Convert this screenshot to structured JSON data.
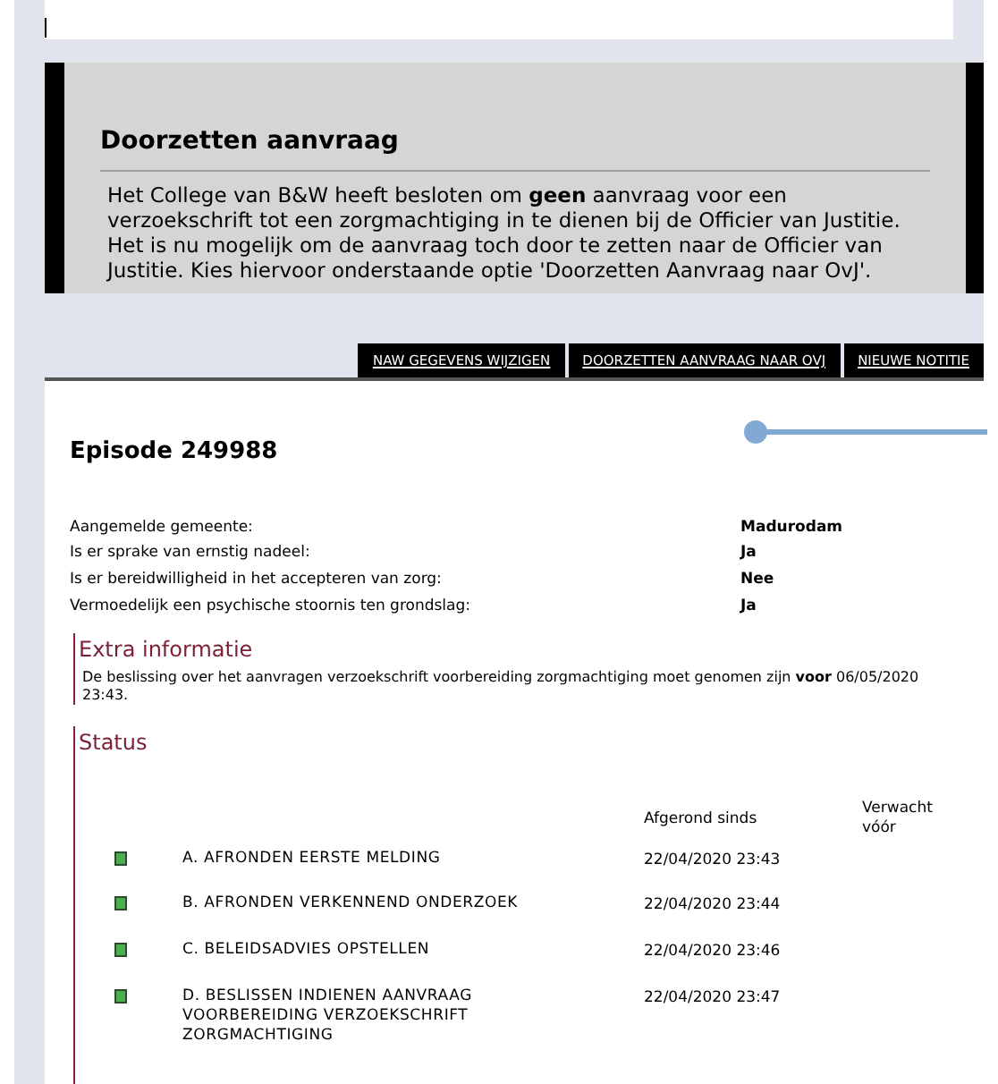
{
  "notice": {
    "title": "Doorzetten aanvraag",
    "body": "Het College van B&W heeft besloten om **geen** aanvraag voor een verzoekschrift tot een zorgmachtiging in te dienen bij de Officier van Justitie. Het is nu mogelijk om de aanvraag toch door te zetten naar de Officier van Justitie. Kies hiervoor onderstaande optie 'Doorzetten Aanvraag naar OvJ'."
  },
  "actions": [
    "NAW GEGEVENS WIJZIGEN",
    "DOORZETTEN AANVRAAG NAAR OVJ",
    "NIEUWE NOTITIE"
  ],
  "episode": {
    "title": "Episode 249988"
  },
  "fields": [
    {
      "label": "Aangemelde gemeente:",
      "value": "Madurodam"
    },
    {
      "label": "Is er sprake van ernstig nadeel:",
      "value": "Ja"
    },
    {
      "label": "Is er bereidwilligheid in het accepteren van zorg:",
      "value": "Nee"
    },
    {
      "label": "Vermoedelijk een psychische stoornis ten grondslag:",
      "value": "Ja"
    }
  ],
  "extra_info": {
    "title": "Extra informatie",
    "text": "De beslissing over het aanvragen verzoekschrift voorbereiding zorgmachtiging moet genomen zijn **voor** 06/05/2020 23:43."
  },
  "status": {
    "title": "Status",
    "columns": [
      "Afgerond sinds",
      "Verwacht vóór"
    ],
    "rows": [
      {
        "step": "A. AFRONDEN EERSTE MELDING",
        "completed": "22/04/2020 23:43",
        "color": "#4caf50"
      },
      {
        "step": "B. AFRONDEN VERKENNEND ONDERZOEK",
        "completed": "22/04/2020 23:44",
        "color": "#4caf50"
      },
      {
        "step": "C. BELEIDSADVIES OPSTELLEN",
        "completed": "22/04/2020 23:46",
        "color": "#4caf50"
      },
      {
        "step": "D. BESLISSEN INDIENEN AANVRAAG VOORBEREIDING VERZOEKSCHRIFT ZORGMACHTIGING",
        "completed": "22/04/2020 23:47",
        "color": "#4caf50"
      }
    ]
  }
}
